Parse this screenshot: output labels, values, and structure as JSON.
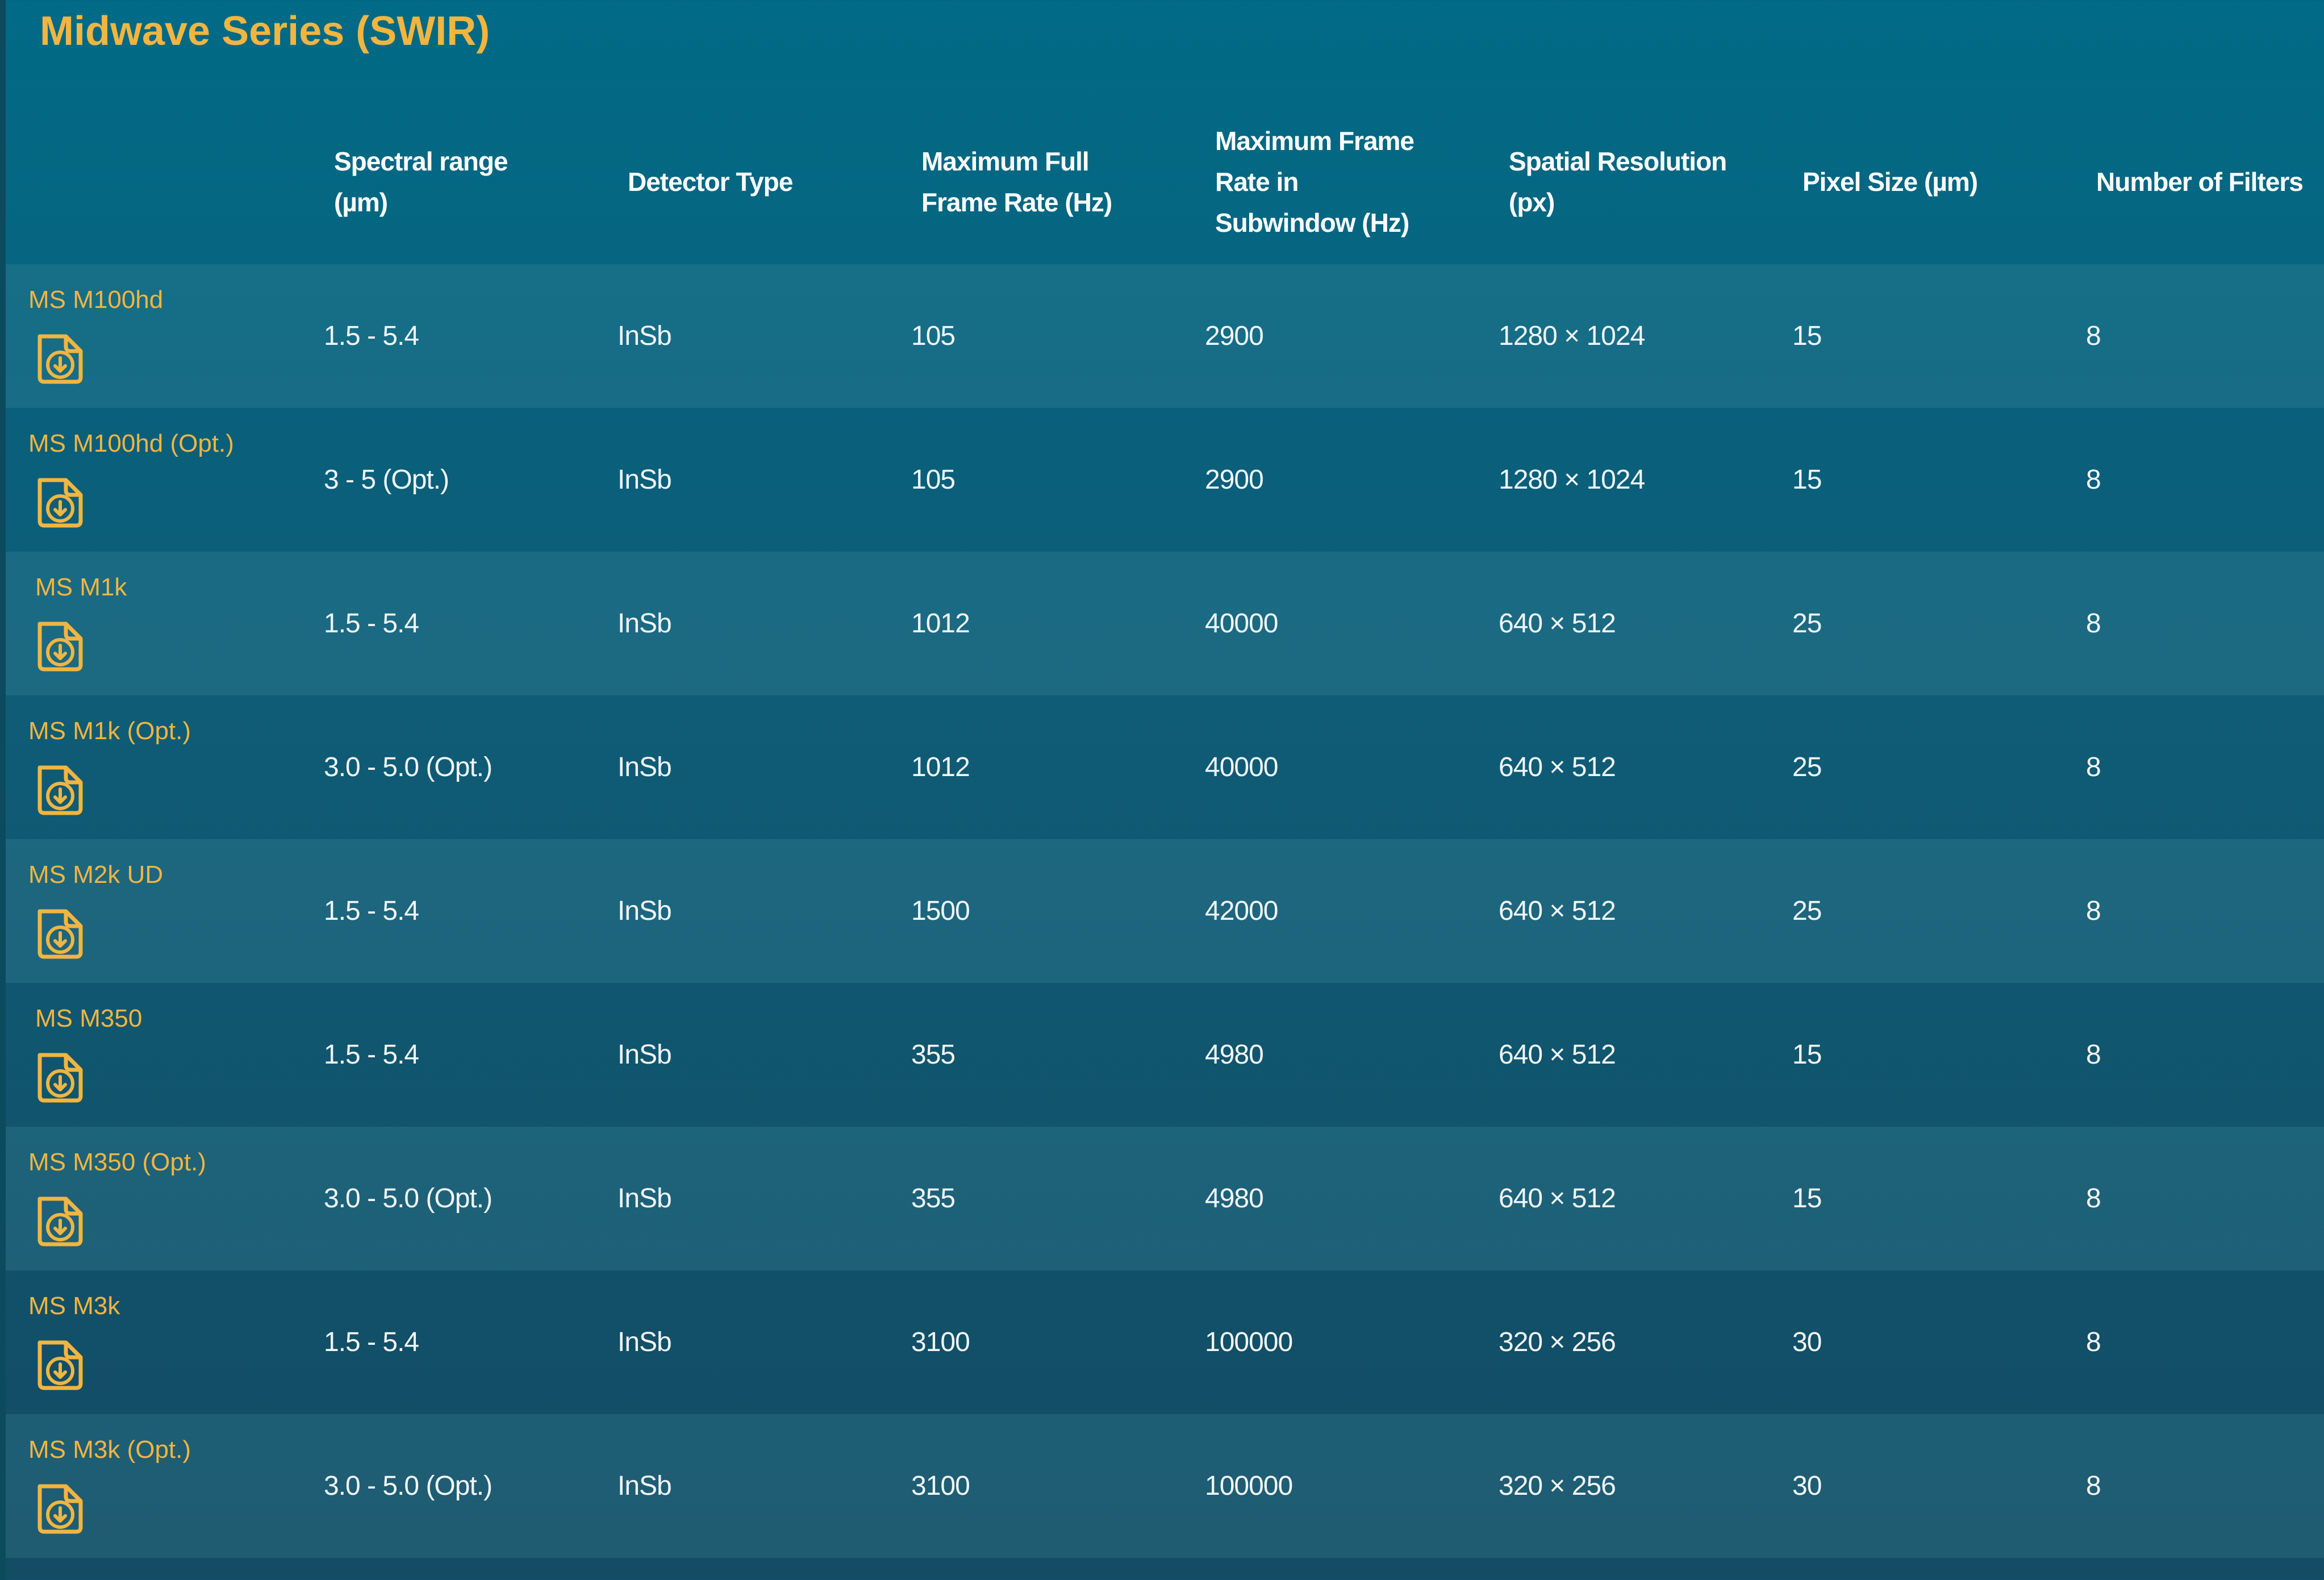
{
  "title": "Midwave Series (SWIR)",
  "columns": [
    "Spectral range\n(µm)",
    "Detector Type",
    "Maximum Full\nFrame Rate (Hz)",
    "Maximum Frame\nRate in\nSubwindow (Hz)",
    "Spatial Resolution\n(px)",
    "Pixel Size (µm)",
    "Number of Filters"
  ],
  "rows": [
    {
      "name": "MS M100hd",
      "cells": [
        "1.5 - 5.4",
        "InSb",
        "105",
        "2900",
        "1280 × 1024",
        "15",
        "8"
      ]
    },
    {
      "name": "MS M100hd (Opt.)",
      "cells": [
        "3 - 5 (Opt.)",
        "InSb",
        "105",
        "2900",
        "1280 × 1024",
        "15",
        "8"
      ]
    },
    {
      "name": "MS M1k",
      "cells": [
        "1.5 - 5.4",
        "InSb",
        "1012",
        "40000",
        "640 × 512",
        "25",
        "8"
      ]
    },
    {
      "name": "MS M1k (Opt.)",
      "cells": [
        "3.0 - 5.0 (Opt.)",
        "InSb",
        "1012",
        "40000",
        "640 × 512",
        "25",
        "8"
      ]
    },
    {
      "name": "MS M2k UD",
      "cells": [
        "1.5 - 5.4",
        "InSb",
        "1500",
        "42000",
        "640 × 512",
        "25",
        "8"
      ]
    },
    {
      "name": "MS M350",
      "cells": [
        "1.5 - 5.4",
        "InSb",
        "355",
        "4980",
        "640 × 512",
        "15",
        "8"
      ]
    },
    {
      "name": "MS M350 (Opt.)",
      "cells": [
        "3.0 - 5.0 (Opt.)",
        "InSb",
        "355",
        "4980",
        "640 × 512",
        "15",
        "8"
      ]
    },
    {
      "name": "MS M3k",
      "cells": [
        "1.5 - 5.4",
        "InSb",
        "3100",
        "100000",
        "320 × 256",
        "30",
        "8"
      ]
    },
    {
      "name": "MS M3k (Opt.)",
      "cells": [
        "3.0 - 5.0 (Opt.)",
        "InSb",
        "3100",
        "100000",
        "320 × 256",
        "30",
        "8"
      ]
    }
  ],
  "icons": {
    "datasheet": "download-document-icon"
  },
  "colors": {
    "accent": "#f1b540",
    "background_top": "#016a86",
    "background_bottom": "#134c63",
    "text": "#f2f7f9"
  }
}
